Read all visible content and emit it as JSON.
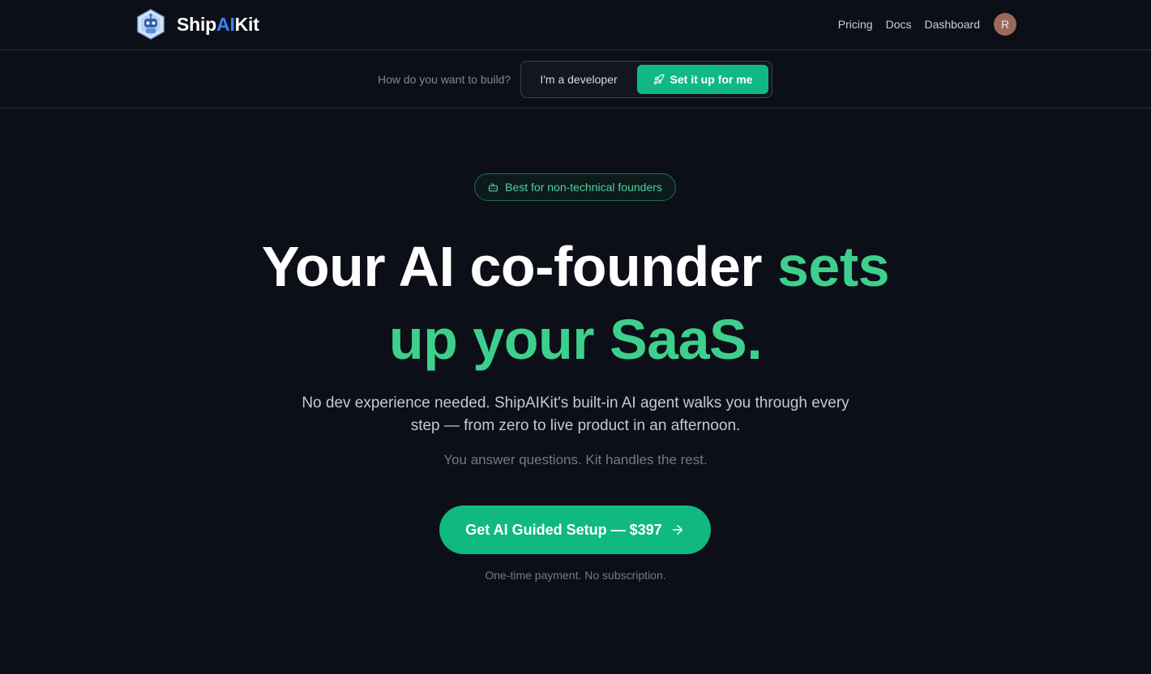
{
  "brand": {
    "name_part1": "Ship",
    "name_part2": "AI",
    "name_part3": "Kit",
    "accent_color": "#3b82f6",
    "logo_icon": "robot-logo-icon"
  },
  "nav": {
    "links": [
      {
        "label": "Pricing"
      },
      {
        "label": "Docs"
      },
      {
        "label": "Dashboard"
      }
    ],
    "avatar_initial": "R"
  },
  "mode": {
    "question": "How do you want to build?",
    "options": [
      {
        "label": "I'm a developer",
        "selected": false
      },
      {
        "label": "Set it up for me",
        "selected": true,
        "icon": "rocket-icon"
      }
    ]
  },
  "hero": {
    "badge": {
      "icon": "robot-icon",
      "label": "Best for non-technical founders"
    },
    "headline_white": "Your AI co-founder ",
    "headline_accent_1": "sets",
    "headline_accent_2": "up your SaaS.",
    "subtitle": "No dev experience needed. ShipAIKit's built-in AI agent walks you through every step — from zero to live product in an afternoon.",
    "tagline": "You answer questions. Kit handles the rest.",
    "cta": {
      "label": "Get AI Guided Setup — $397",
      "icon": "arrow-right-icon"
    },
    "cta_note": "One-time payment. No subscription."
  },
  "colors": {
    "background": "#0c0f17",
    "accent_green": "#10b981",
    "headline_green": "#3ecf8e"
  }
}
